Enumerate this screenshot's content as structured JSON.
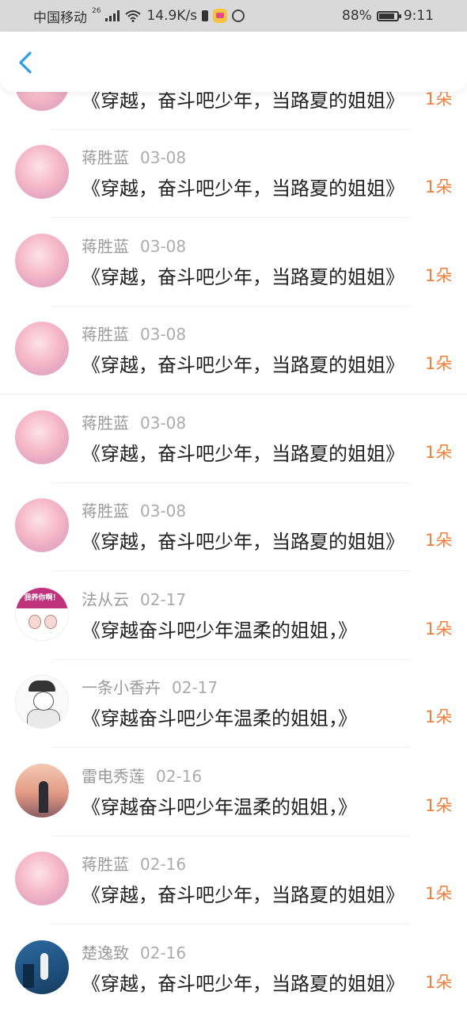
{
  "status_bar": {
    "carrier": "中国移动",
    "network": "26",
    "speed": "14.9K/s",
    "battery_pct": "88%",
    "battery_level": 0.88,
    "time": "9:11"
  },
  "header": {
    "back_icon": "chevron-left-icon",
    "accent": "#2f9de4"
  },
  "colors": {
    "count": "#ef7f3c",
    "name": "#9a9a9a",
    "content": "#222222"
  },
  "items": [
    {
      "name": "",
      "date": "",
      "content": "《穿越，奋斗吧少年，当路夏的姐姐》",
      "count": "1朵",
      "avatar": "anime"
    },
    {
      "name": "蒋胜蓝",
      "date": "03-08",
      "content": "《穿越，奋斗吧少年，当路夏的姐姐》",
      "count": "1朵",
      "avatar": "anime"
    },
    {
      "name": "蒋胜蓝",
      "date": "03-08",
      "content": "《穿越，奋斗吧少年，当路夏的姐姐》",
      "count": "1朵",
      "avatar": "anime"
    },
    {
      "name": "蒋胜蓝",
      "date": "03-08",
      "content": "《穿越，奋斗吧少年，当路夏的姐姐》",
      "count": "1朵",
      "avatar": "anime"
    },
    {
      "name": "蒋胜蓝",
      "date": "03-08",
      "content": "《穿越，奋斗吧少年，当路夏的姐姐》",
      "count": "1朵",
      "avatar": "anime"
    },
    {
      "name": "蒋胜蓝",
      "date": "03-08",
      "content": "《穿越，奋斗吧少年，当路夏的姐姐》",
      "count": "1朵",
      "avatar": "anime"
    },
    {
      "name": "法从云",
      "date": "02-17",
      "content": "《穿越奋斗吧少年温柔的姐姐，》",
      "count": "1朵",
      "avatar": "couple",
      "avatar_text": "我养你啊！"
    },
    {
      "name": "一条小香卉",
      "date": "02-17",
      "content": "《穿越奋斗吧少年温柔的姐姐，》",
      "count": "1朵",
      "avatar": "sketch"
    },
    {
      "name": "雷电秀莲",
      "date": "02-16",
      "content": "《穿越奋斗吧少年温柔的姐姐，》",
      "count": "1朵",
      "avatar": "sunset"
    },
    {
      "name": "蒋胜蓝",
      "date": "02-16",
      "content": "《穿越，奋斗吧少年，当路夏的姐姐》",
      "count": "1朵",
      "avatar": "anime"
    },
    {
      "name": "楚逸致",
      "date": "02-16",
      "content": "《穿越，奋斗吧少年，当路夏的姐姐》",
      "count": "1朵",
      "avatar": "blue"
    }
  ]
}
